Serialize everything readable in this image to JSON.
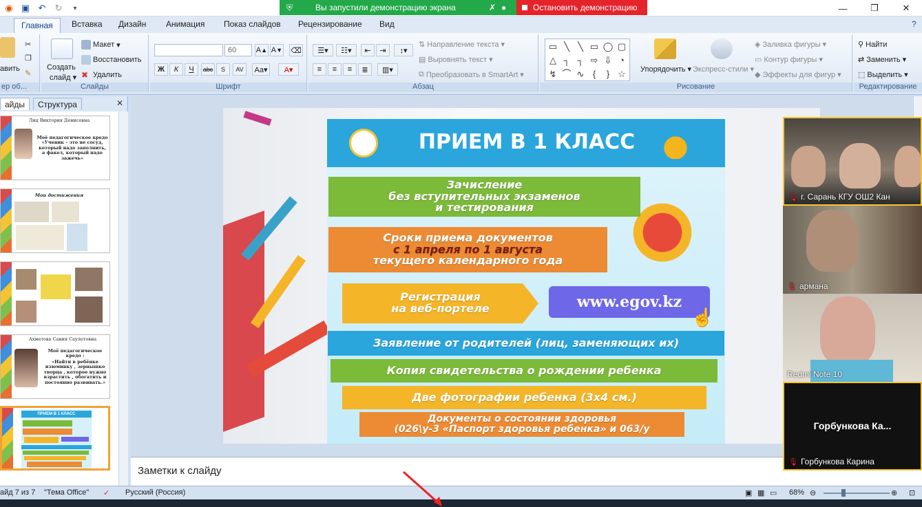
{
  "share_banner": {
    "text": "Вы запустили демонстрацию экрана",
    "stop_label": "Остановить демонстрацию"
  },
  "ribbon": {
    "tabs": [
      "Главная",
      "Вставка",
      "Дизайн",
      "Анимация",
      "Показ слайдов",
      "Рецензирование",
      "Вид"
    ],
    "clipboard": {
      "paste": "авить",
      "title": "ер об..."
    },
    "slides": {
      "create": "Создать",
      "create2": "слайд",
      "layout": "Макет",
      "restore": "Восстановить",
      "delete": "Удалить",
      "title": "Слайды"
    },
    "font": {
      "size": "60",
      "title": "Шрифт"
    },
    "paragraph": {
      "text_dir": "Направление текста",
      "align_text": "Выровнять текст",
      "smartart": "Преобразовать в SmartArt",
      "title": "Абзац"
    },
    "drawing": {
      "arrange": "Упорядочить",
      "quick_styles": "Экспресс-стили",
      "fill": "Заливка фигуры",
      "outline": "Контур фигуры",
      "effects": "Эффекты для фигур",
      "title": "Рисование"
    },
    "editing": {
      "find": "Найти",
      "replace": "Заменить",
      "select": "Выделить",
      "title": "Редактирование"
    }
  },
  "panel": {
    "tabs": [
      "айды",
      "Структура"
    ],
    "thumb1": {
      "name": "Лиц Виктория Денисовна",
      "text": "Моё педагогическое кредо «Ученик – это не сосуд, который надо заполнить, а факел, который надо зажечь»"
    },
    "thumb2": {
      "title": "Мои достижения"
    },
    "thumb4": {
      "name": "Ахметова Сания Саулетовна",
      "subtitle": "Моё педагогическое кредо :",
      "text": "«Найти в ребёнке изюминку , зернышко творца , которое нужно взрастить , обогатить и постоянно развивать.»"
    },
    "thumb5": {
      "title": "ПРИЕМ В 1 КЛАСС"
    }
  },
  "slide": {
    "title": "ПРИЕМ В 1 КЛАСС",
    "bar1": [
      "Зачисление",
      "без вступительных экзаменов",
      "и тестирования"
    ],
    "bar2": [
      "Сроки приема документов",
      "с 1 апреля по 1 августа",
      "текущего календарного года"
    ],
    "bar3": [
      "Регистрация",
      "на веб-портеле"
    ],
    "egov": "www.egov.kz",
    "bar4": "Заявление от родителей (лиц, заменяющих их)",
    "bar5": "Копия свидетельства о рождении ребенка",
    "bar6": "Две фотографии ребенка  (3х4 см.)",
    "bar7": [
      "Документы о состоянии здоровья",
      "(026\\у-3 «Паспорт здоровья ребенка» и 063/у"
    ]
  },
  "notes_placeholder": "Заметки к слайду",
  "participants": [
    {
      "name": "г. Сарань КГУ ОШ2 Кан"
    },
    {
      "name": "армана"
    },
    {
      "name": "Redmi Note 10"
    },
    {
      "name": "Горбункова Карина",
      "display": "Горбункова  Ка..."
    }
  ],
  "status": {
    "slide": "айд 7 из 7",
    "theme": "\"Тема Office\"",
    "lang": "Русский (Россия)",
    "zoom": "68%"
  },
  "colors": {
    "ribbon_accent": "#15428b",
    "banner_green": "#23a84a",
    "stop_red": "#e4232a"
  }
}
